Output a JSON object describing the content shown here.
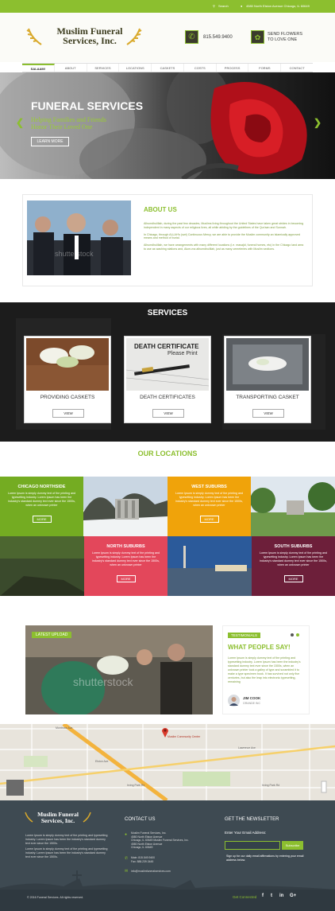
{
  "topbar": {
    "search_label": "Search",
    "address": "4580 North Elston Avenue Chicago, IL 60649"
  },
  "header": {
    "logo_line1": "Muslim Funeral",
    "logo_line2": "Services, Inc.",
    "phone": "815.549.9400",
    "send_flowers_line1": "SEND FLOWERS",
    "send_flowers_line2": "TO LOVE ONE"
  },
  "nav": {
    "items": [
      "SALAAM!",
      "ABOUT",
      "SERVICES",
      "LOCATIONS",
      "CASKETS",
      "COSTS",
      "PROCESS",
      "FORMS",
      "CONTACT"
    ],
    "active": 0
  },
  "hero": {
    "title": "FUNERAL SERVICES",
    "subtitle_line1": "Helping Families and Friends",
    "subtitle_line2": "Honor Their Loved One",
    "button": "LEARN MORE",
    "prev": "❮",
    "next": "❯"
  },
  "about": {
    "heading": "ABOUT US",
    "p1": "Alhumdhulillah, during the past few decades, Muslims living throughout the United States have taken great strides in becoming independent in many aspects of our religious lives, all while abiding by the guidelines of the Qur'aan and Sunnah.",
    "p2": "In Chicago, through ALLAH's (swt) Continuous Mercy, we are able to provide the Muslim community an Islamically approved means and method of burial.",
    "p3": "Alhumdhulillah, we have arrangements with many different locations (i.e. masajid, funeral homes, etc) in the Chicago land area to use as washing stations and, Alum-ma alhumdhulillah, just as many cemeteries with Muslim sections."
  },
  "services": {
    "heading": "SERVICES",
    "items": [
      {
        "title": "PROVIDING CASKETS",
        "button": "VIEW"
      },
      {
        "title": "DEATH CERTIFICATES",
        "button": "VIEW"
      },
      {
        "title": "TRANSPORTING CASKET",
        "button": "VIEW"
      }
    ],
    "cert_line1": "DEATH CERTIFICATE",
    "cert_line2": "Please Print"
  },
  "locations": {
    "heading": "OUR LOCATIONS",
    "items": [
      {
        "name": "CHICAGO NORTHSIDE",
        "text": "Lorem Ipsum is simply dummy text of the printing and typesetting industry. Lorem Ipsum has been the industry's standard dummy text ever since the 1500s, when an unknown printer",
        "button": "MORE"
      },
      {
        "name": "WEST SUBURBS",
        "text": "Lorem Ipsum is simply dummy text of the printing and typesetting industry. Lorem Ipsum has been the industry's standard dummy text ever since the 1500s, when an unknown printer",
        "button": "MORE"
      },
      {
        "name": "NORTH SUBURBS",
        "text": "Lorem Ipsum is simply dummy text of the printing and typesetting industry. Lorem Ipsum has been the industry's standard dummy text ever since the 1500s, when an unknown printer",
        "button": "MORE"
      },
      {
        "name": "SOUTH SUBURBS",
        "text": "Lorem Ipsum is simply dummy text of the printing and typesetting industry. Lorem Ipsum has been the industry's standard dummy text ever since the 1500s, when an unknown printer",
        "button": "MORE"
      }
    ]
  },
  "latest": {
    "badge": "LATEST UPLOAD"
  },
  "testimonial": {
    "badge": "TESTIMONIALS",
    "heading": "WHAT PEOPLE SAY!",
    "text": "Lorem Ipsum is simply dummy text of the printing and typesetting industry. Lorem Ipsum has been the industry's standard dummy text ever since the 1500s, when an unknown printer took a galley of type and scrambled it to make a type specimen book. It has survived not only five centuries, but also the leap into electronic typesetting, remaining",
    "name": "JIM COOK",
    "role": "GRANDE INC"
  },
  "map": {
    "marker_label": "Muslim Community Center",
    "streets": [
      "Montrose Ave",
      "Irving Park Rd",
      "Lawrence Ave",
      "Elston Ave",
      "Irving Park Rd"
    ]
  },
  "footer": {
    "logo_line1": "Muslim Funeral",
    "logo_line2": "Services, Inc.",
    "about_text1": "Lorem Ipsum is simply dummy text of the printing and typesetting industry. Lorem Ipsum has been the industry's standard dummy text ever since the 1500s.",
    "about_text2": "Lorem Ipsum is simply dummy text of the printing and typesetting industry. Lorem Ipsum has been the industry's standard dummy text ever since the 1500s.",
    "contact_heading": "CONTACT US",
    "address_lines": [
      "Muslim Funeral Services, Inc.",
      "4580 North Elston Avenue",
      "Chicago, IL 60649 Muslim Funeral Services, Inc.",
      "4580 North Elston Avenue",
      "Chicago, IL 60649"
    ],
    "main_phone_label": "Main:",
    "main_phone": "815.549.9400",
    "fax_label": "Fax:",
    "fax": "888.239.3445",
    "email": "info@muslimfuneralservices.com",
    "newsletter_heading": "GET THE NEWSLETTER",
    "email_label": "Enter Your Email Address:",
    "subscribe": "Subscribe",
    "newsletter_text": "Sign up for our daily email affirmations by entering your email address below.",
    "copyright": "© 2016 Funeral Services. All rights reserved.",
    "get_connected": "Get Connected",
    "social": [
      "f",
      "t",
      "in",
      "G+"
    ]
  },
  "colors": {
    "green": "#8cbf2f",
    "orange": "#f0a30a",
    "red": "#e3475b",
    "maroon": "#6d1f3a",
    "footer": "#3e4a52"
  }
}
